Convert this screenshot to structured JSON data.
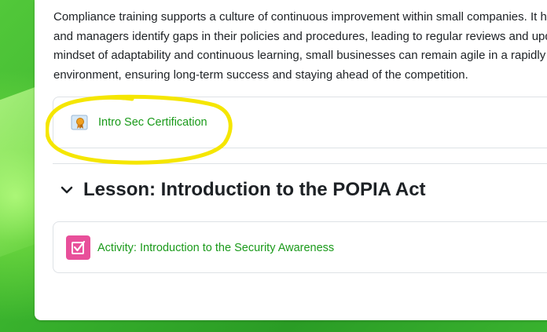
{
  "intro": {
    "lines": [
      "Compliance training supports a culture of continuous improvement within small companies. It h",
      "and managers identify gaps in their policies and procedures, leading to regular reviews and upd",
      "mindset of adaptability and continuous learning, small businesses can remain agile in a rapidly",
      "environment, ensuring long-term success and staying ahead of the competition."
    ]
  },
  "certificate": {
    "label": "Intro Sec Certification",
    "icon": "certificate-icon",
    "highlight_color": "#f5e600"
  },
  "section": {
    "title": "Lesson: Introduction to the POPIA Act",
    "collapse_icon": "chevron-down-icon"
  },
  "activity": {
    "label": "Activity: Introduction to the Security Awareness",
    "icon": "checkbox-edit-icon",
    "icon_color": "#e84f9a"
  },
  "colors": {
    "link": "#1a9a1a",
    "text": "#1d2125",
    "border": "#dee2e6",
    "background_green": "#37b02c"
  }
}
